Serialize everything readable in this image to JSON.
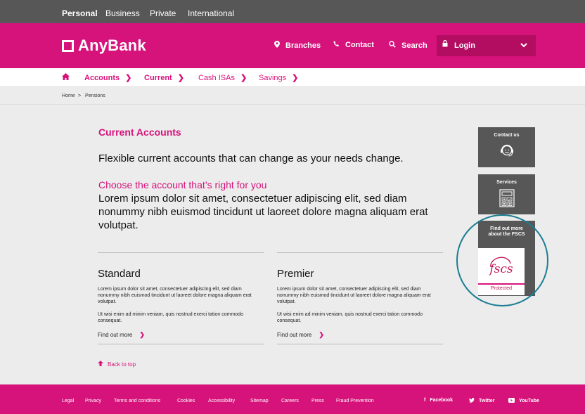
{
  "topnav": {
    "items": [
      "Personal",
      "Business",
      "Private",
      "International"
    ]
  },
  "brand": {
    "name": "AnyBank"
  },
  "header_nav": {
    "branches": "Branches",
    "contact": "Contact",
    "search": "Search",
    "login": "Login"
  },
  "product_nav": {
    "items": [
      {
        "label": "Accounts"
      },
      {
        "label": "Current"
      },
      {
        "label": "Cash ISAs"
      },
      {
        "label": "Savings"
      }
    ]
  },
  "breadcrumb": {
    "home": "Home",
    "sep": ">",
    "current": "Pensions"
  },
  "main": {
    "title": "Current Accounts",
    "lead": "Flexible current accounts that can change as your needs change.",
    "subheading": "Choose the account that’s right for you",
    "body": "Lorem ipsum dolor sit amet, consectetuer adipiscing elit, sed diam nonummy nibh euismod tincidunt ut laoreet dolore magna aliquam erat volutpat.",
    "columns": [
      {
        "heading": "Standard",
        "para1": "Lorem ipsum dolor sit amet, consectetuer adipiscing elit, sed diam nonummy nibh euismod tincidunt ut laoreet dolore magna aliquam erat volutpat.",
        "para2": "Ut wisi enim ad minim veniam, quis nostrud exerci tation commodo consequat.",
        "link": "Find out more"
      },
      {
        "heading": "Premier",
        "para1": "Lorem ipsum dolor sit amet, consectetuer adipiscing elit, sed diam nonummy nibh euismod tincidunt ut laoreet dolore magna aliquam erat volutpat.",
        "para2": "Ut wisi enim ad minim veniam, quis nostrud exerci tation commodo consequat.",
        "link": "Find out more"
      }
    ],
    "back_to_top": "Back to top"
  },
  "sidebar": {
    "contact_us": "Contact us",
    "services": "Services",
    "fscs_line1": "Find out more",
    "fscs_line2": "about the FSCS",
    "fscs_logo": "fscs",
    "fscs_protected": "Protected"
  },
  "footer": {
    "links": [
      "Legal",
      "Privacy",
      "Terms and conditions",
      "Cookies",
      "Accessibility",
      "Sitemap",
      "Careers",
      "Press",
      "Fraud Prevention"
    ],
    "social": [
      "Facebook",
      "Twitter",
      "YouTube"
    ]
  },
  "colors": {
    "brand_pink": "#d6127b",
    "login_pink": "#b30d62",
    "dark_grey": "#575757",
    "page_grey": "#ececec",
    "ring_teal": "#1b7d92"
  },
  "icons": {
    "home": "home-icon",
    "branches": "map-pin-icon",
    "contact": "phone-icon",
    "search": "search-icon",
    "login": "lock-icon",
    "dropdown": "chevron-down-icon",
    "contact_us": "headset-icon",
    "services": "calculator-icon",
    "back_to_top": "arrow-up-icon"
  }
}
